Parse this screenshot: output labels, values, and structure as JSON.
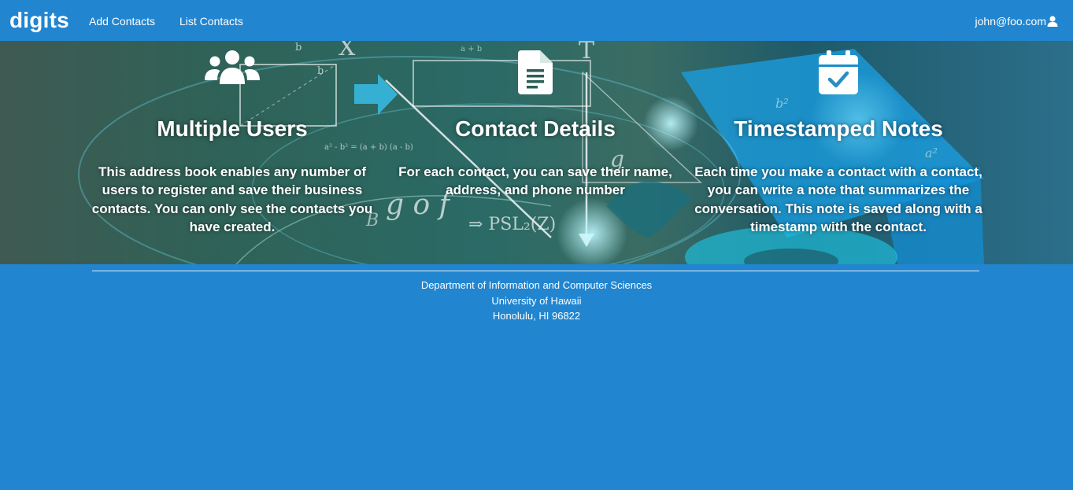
{
  "navbar": {
    "brand": "digits",
    "links": [
      "Add Contacts",
      "List Contacts"
    ],
    "user_email": "john@foo.com",
    "user_icon": "user-icon"
  },
  "features": [
    {
      "icon": "users-icon",
      "title": "Multiple Users",
      "text": "This address book enables any number of users to register and save their business contacts. You can only see the contacts you have created."
    },
    {
      "icon": "file-text-icon",
      "title": "Contact Details",
      "text": "For each contact, you can save their name, address, and phone number"
    },
    {
      "icon": "calendar-check-icon",
      "title": "Timestamped Notes",
      "text": "Each time you make a contact with a contact, you can write a note that summarizes the conversation. This note is saved along with a timestamp with the contact."
    }
  ],
  "footer": {
    "lines": [
      "Department of Information and Computer Sciences",
      "University of Hawaii",
      "Honolulu, HI 96822"
    ]
  },
  "colors": {
    "primary": "#2185d0",
    "text": "#ffffff"
  }
}
